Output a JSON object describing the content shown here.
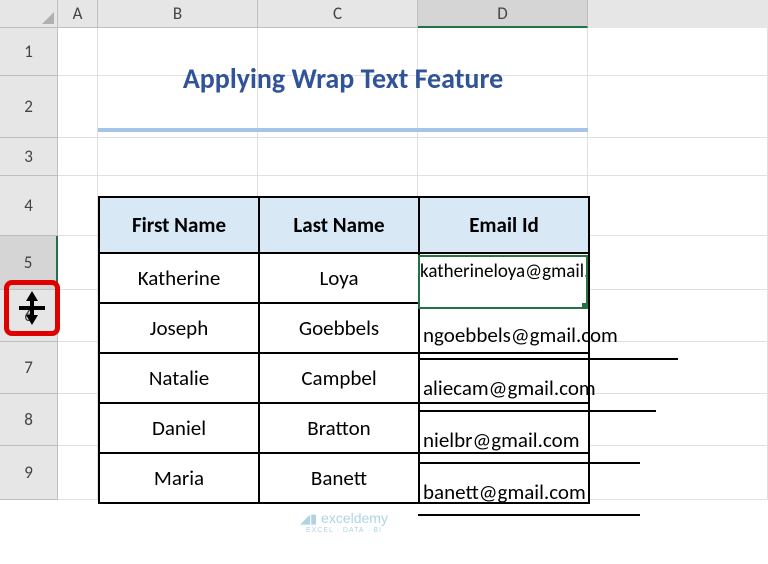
{
  "columns": {
    "A": "A",
    "B": "B",
    "C": "C",
    "D": "D"
  },
  "rows": {
    "1": "1",
    "2": "2",
    "3": "3",
    "4": "4",
    "5": "5",
    "6": "6",
    "7": "7",
    "8": "8",
    "9": "9"
  },
  "title": "Applying Wrap Text Feature",
  "headers": {
    "b": "First Name",
    "c": "Last Name",
    "d": "Email Id"
  },
  "selected_cell_text": "katherineloya@gmail.com",
  "table": [
    {
      "first": "Katherine",
      "last": "Loya"
    },
    {
      "first": "Joseph",
      "last": "Goebbels"
    },
    {
      "first": "Natalie",
      "last": "Campbel"
    },
    {
      "first": "Daniel",
      "last": "Bratton"
    },
    {
      "first": "Maria",
      "last": "Banett"
    }
  ],
  "emails_overflow": {
    "r6": "ngoebbels@gmail.com",
    "r7": "aliecam@gmail.com",
    "r8": "nielbr@gmail.com",
    "r9": "banett@gmail.com"
  },
  "watermark": {
    "brand": "exceldemy",
    "tag": "EXCEL · DATA · BI"
  }
}
